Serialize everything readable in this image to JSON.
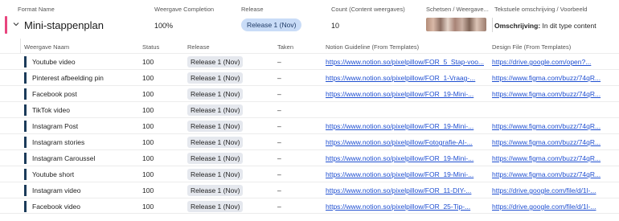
{
  "top_headers": {
    "format_name": "Format Name",
    "weergave_completion": "Weergave Completion",
    "release": "Release",
    "count": "Count (Content weergaves)",
    "schetsen": "Schetsen / Weergave...",
    "tekstuele": "Tekstuele omschrijving / Voorbeeld"
  },
  "group": {
    "name": "Mini-stappenplan",
    "completion": "100%",
    "release": "Release 1 (Nov)",
    "count": "10",
    "desc_label": "Omschrijving:",
    "desc_text": " In dit type content",
    "accent_color": "#e8457e"
  },
  "sub_headers": {
    "weergave_naam": "Weergave Naam",
    "status": "Status",
    "release": "Release",
    "taken": "Taken",
    "notion_guideline": "Notion Guideline (From Templates)",
    "design_file": "Design File (From Templates)"
  },
  "rows": [
    {
      "name": "Youtube video",
      "status": "100",
      "release": "Release 1 (Nov)",
      "taken": "–",
      "notion": "https://www.notion.so/pixelpillow/FOR_5_Stap-voo...",
      "design": "https://drive.google.com/open?..."
    },
    {
      "name": "Pinterest afbeelding pin",
      "status": "100",
      "release": "Release 1 (Nov)",
      "taken": "–",
      "notion": "https://www.notion.so/pixelpillow/FOR_1-Vraag-...",
      "design": "https://www.figma.com/buzz/74qR..."
    },
    {
      "name": "Facebook post",
      "status": "100",
      "release": "Release 1 (Nov)",
      "taken": "–",
      "notion": "https://www.notion.so/pixelpillow/FOR_19-Mini-...",
      "design": "https://www.figma.com/buzz/74qR..."
    },
    {
      "name": "TikTok video",
      "status": "100",
      "release": "Release 1 (Nov)",
      "taken": "–",
      "notion": "",
      "design": ""
    },
    {
      "name": "Instagram Post",
      "status": "100",
      "release": "Release 1 (Nov)",
      "taken": "–",
      "notion": "https://www.notion.so/pixelpillow/FOR_19-Mini-...",
      "design": "https://www.figma.com/buzz/74qR..."
    },
    {
      "name": "Instagram stories",
      "status": "100",
      "release": "Release 1 (Nov)",
      "taken": "–",
      "notion": "https://www.notion.so/pixelpillow/Fotografie-AI-...",
      "design": "https://www.figma.com/buzz/74qR..."
    },
    {
      "name": "Instagram Caroussel",
      "status": "100",
      "release": "Release 1 (Nov)",
      "taken": "–",
      "notion": "https://www.notion.so/pixelpillow/FOR_19-Mini-...",
      "design": "https://www.figma.com/buzz/74qR..."
    },
    {
      "name": "Youtube short",
      "status": "100",
      "release": "Release 1 (Nov)",
      "taken": "–",
      "notion": "https://www.notion.so/pixelpillow/FOR_19-Mini-...",
      "design": "https://www.figma.com/buzz/74qR..."
    },
    {
      "name": "Instagram video",
      "status": "100",
      "release": "Release 1 (Nov)",
      "taken": "–",
      "notion": "https://www.notion.so/pixelpillow/FOR_11-DIY-...",
      "design": "https://drive.google.com/file/d/1l-..."
    },
    {
      "name": "Facebook video",
      "status": "100",
      "release": "Release 1 (Nov)",
      "taken": "–",
      "notion": "https://www.notion.so/pixelpillow/FOR_25-Tip-...",
      "design": "https://drive.google.com/file/d/1l-..."
    }
  ],
  "colors": {
    "row_bar": "#1b3b5a",
    "link": "#1f4fd1",
    "release_pill_group": "#c9dcf7",
    "release_pill_row": "#e5e8ee"
  }
}
